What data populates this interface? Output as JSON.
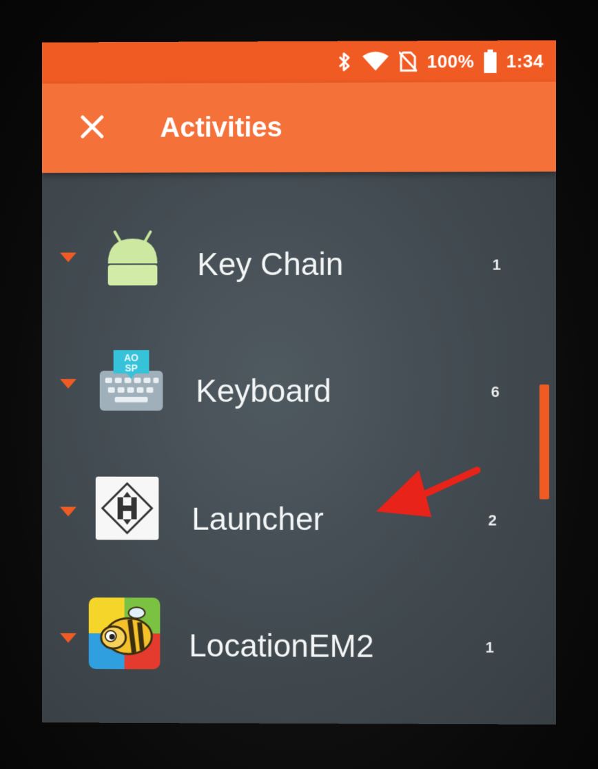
{
  "status_bar": {
    "battery_percent": "100%",
    "time": "1:34",
    "icons": [
      "bluetooth-icon",
      "wifi-icon",
      "no-sim-icon",
      "battery-icon"
    ],
    "color": "#f05b24"
  },
  "app_bar": {
    "title": "Activities",
    "close_icon": "close-icon",
    "color": "#f4713a"
  },
  "list": {
    "items": [
      {
        "label": "Key Chain",
        "count": "1",
        "icon": "android-icon"
      },
      {
        "label": "Keyboard",
        "count": "6",
        "icon": "aosp-keyboard-icon"
      },
      {
        "label": "Launcher",
        "count": "2",
        "icon": "launcher-icon"
      },
      {
        "label": "LocationEM2",
        "count": "1",
        "icon": "bee-icon"
      }
    ]
  },
  "annotation": {
    "arrow_color": "#e8231a",
    "points_to": "Launcher"
  },
  "colors": {
    "accent": "#f05b24",
    "background": "#434c52"
  }
}
